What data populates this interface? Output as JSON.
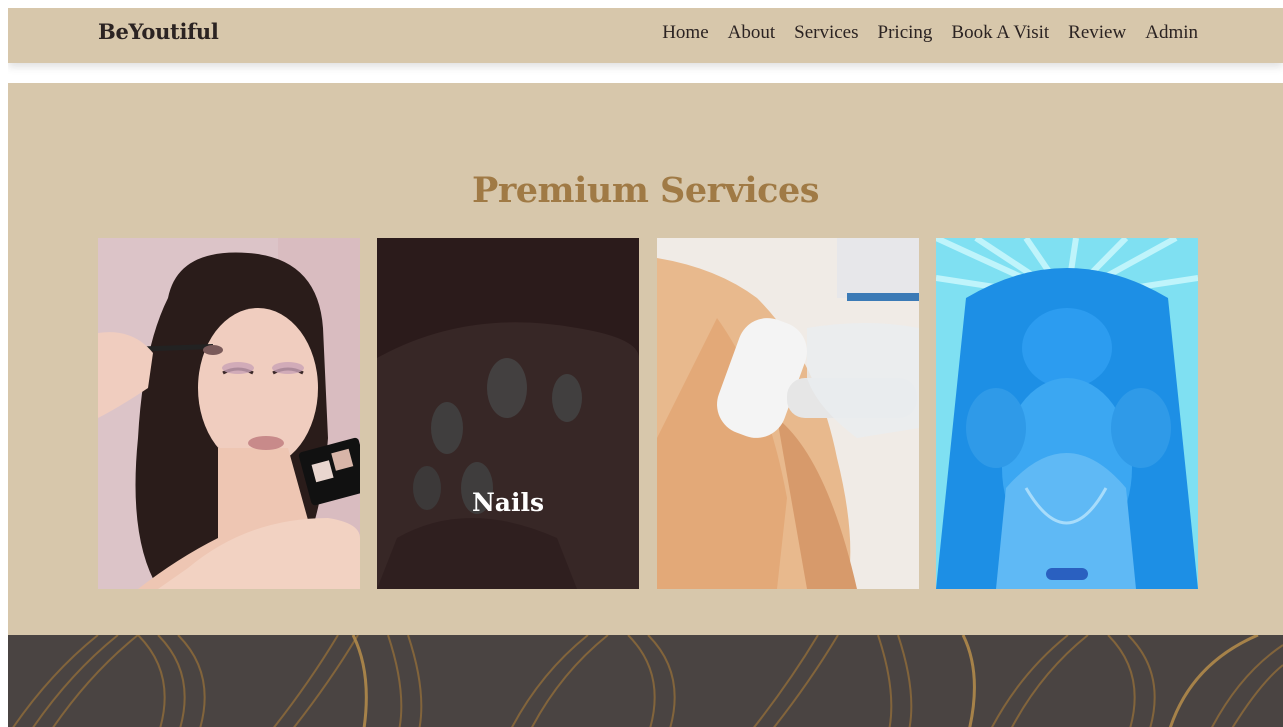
{
  "brand": "BeYoutiful",
  "nav": {
    "items": [
      {
        "label": "Home"
      },
      {
        "label": "About"
      },
      {
        "label": "Services"
      },
      {
        "label": "Pricing"
      },
      {
        "label": "Book A Visit"
      },
      {
        "label": "Review"
      },
      {
        "label": "Admin"
      }
    ]
  },
  "services": {
    "title": "Premium Services",
    "cards": [
      {
        "id": "makeup",
        "label": ""
      },
      {
        "id": "nails",
        "label": "Nails"
      },
      {
        "id": "laser",
        "label": ""
      },
      {
        "id": "tanning",
        "label": ""
      }
    ]
  },
  "colors": {
    "beige": "#d7c7ab",
    "title_gold": "#a07a45",
    "footer_dark": "#4a4442",
    "text_dark": "#2b2322"
  }
}
